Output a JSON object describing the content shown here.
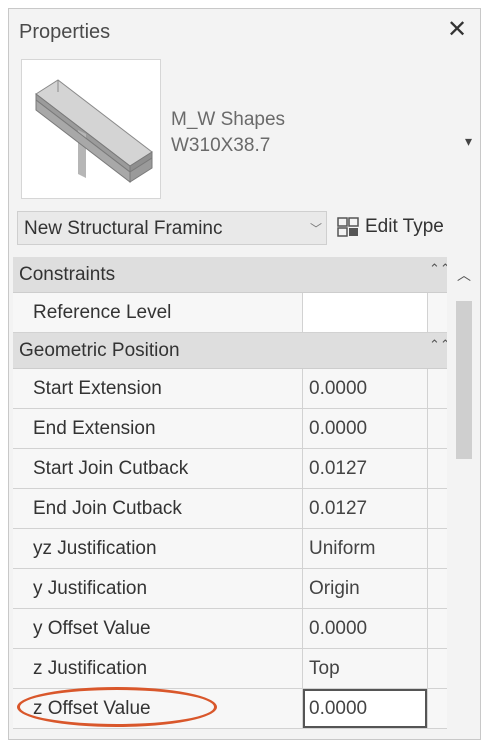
{
  "window": {
    "title": "Properties",
    "close_icon": "close-icon"
  },
  "type_selector": {
    "family": "M_W Shapes",
    "type": "W310X38.7",
    "preview_icon": "i-beam-icon",
    "dropdown_icon": "chevron-down-icon"
  },
  "instance_selector": {
    "label": "New Structural Framinc",
    "dropdown_icon": "chevron-down-icon",
    "edit_type_label": "Edit Type",
    "edit_type_icon": "edit-type-icon"
  },
  "groups": {
    "constraints": {
      "label": "Constraints"
    },
    "geometric_position": {
      "label": "Geometric Position"
    }
  },
  "rows": {
    "reference_level": {
      "name": "Reference Level",
      "value": ""
    },
    "start_extension": {
      "name": "Start Extension",
      "value": "0.0000"
    },
    "end_extension": {
      "name": "End Extension",
      "value": "0.0000"
    },
    "start_join_cutback": {
      "name": "Start Join Cutback",
      "value": "0.0127"
    },
    "end_join_cutback": {
      "name": "End Join Cutback",
      "value": "0.0127"
    },
    "yz_justification": {
      "name": "yz Justification",
      "value": "Uniform"
    },
    "y_justification": {
      "name": "y Justification",
      "value": "Origin"
    },
    "y_offset_value": {
      "name": "y Offset Value",
      "value": "0.0000"
    },
    "z_justification": {
      "name": "z Justification",
      "value": "Top"
    },
    "z_offset_value": {
      "name": "z Offset Value",
      "value": "0.0000"
    }
  },
  "colors": {
    "highlight": "#d9572b",
    "group_bg": "#dedede",
    "panel_bg": "#f3f3f3"
  }
}
